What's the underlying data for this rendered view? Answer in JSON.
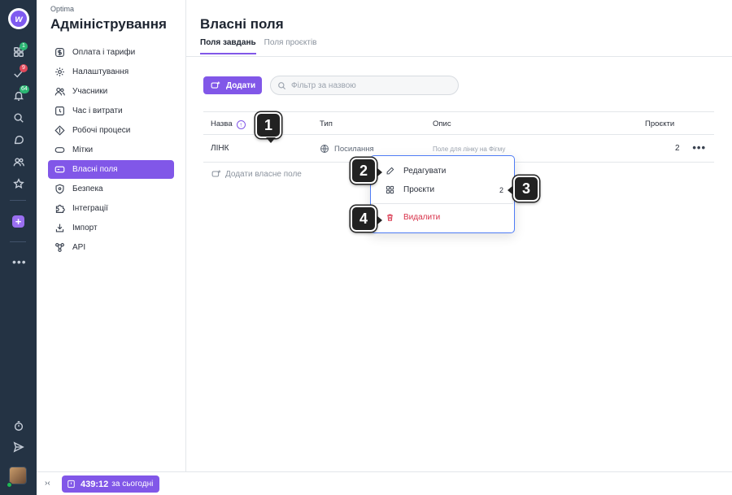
{
  "rail": {
    "badges": {
      "apps": "1",
      "tasks": "9",
      "notifications": "64"
    },
    "colors": {
      "apps_badge": "#2bb673",
      "tasks_badge": "#e0485a",
      "notifications_badge": "#2bb673"
    }
  },
  "sidebar": {
    "org": "Optima",
    "title": "Адміністрування",
    "items": [
      {
        "label": "Оплата і тарифи",
        "icon": "dollar-icon"
      },
      {
        "label": "Налаштування",
        "icon": "gear-icon"
      },
      {
        "label": "Учасники",
        "icon": "users-icon"
      },
      {
        "label": "Час і витрати",
        "icon": "clock-icon"
      },
      {
        "label": "Робочі процеси",
        "icon": "workflow-icon"
      },
      {
        "label": "Мітки",
        "icon": "tag-icon"
      },
      {
        "label": "Власні поля",
        "icon": "custom-field-icon",
        "active": true
      },
      {
        "label": "Безпека",
        "icon": "shield-icon"
      },
      {
        "label": "Інтеграції",
        "icon": "puzzle-icon"
      },
      {
        "label": "Імпорт",
        "icon": "import-icon"
      },
      {
        "label": "API",
        "icon": "api-icon"
      }
    ]
  },
  "main": {
    "title": "Власні поля",
    "tabs": [
      {
        "label": "Поля завдань",
        "active": true
      },
      {
        "label": "Поля проєктів",
        "active": false
      }
    ],
    "add_button": "Додати",
    "filter_placeholder": "Фільтр за назвою",
    "table": {
      "headers": {
        "name": "Назва",
        "type": "Тип",
        "description": "Опис",
        "projects": "Проєкти"
      },
      "rows": [
        {
          "name": "ЛІНК",
          "type": "Посилання",
          "description": "Поле для лінку на Фігму",
          "projects": "2"
        }
      ],
      "add_field": "Додати власне поле"
    }
  },
  "context_menu": {
    "edit": "Редагувати",
    "projects": "Проєкти",
    "projects_count": "2",
    "delete": "Видалити"
  },
  "callouts": [
    "1",
    "2",
    "3",
    "4"
  ],
  "footer": {
    "timer_value": "439:12",
    "timer_suffix": "за сьогодні"
  },
  "colors": {
    "accent": "#8157e8",
    "danger": "#d8324a",
    "rail": "#243344",
    "menu_border": "#4f7cf5"
  }
}
